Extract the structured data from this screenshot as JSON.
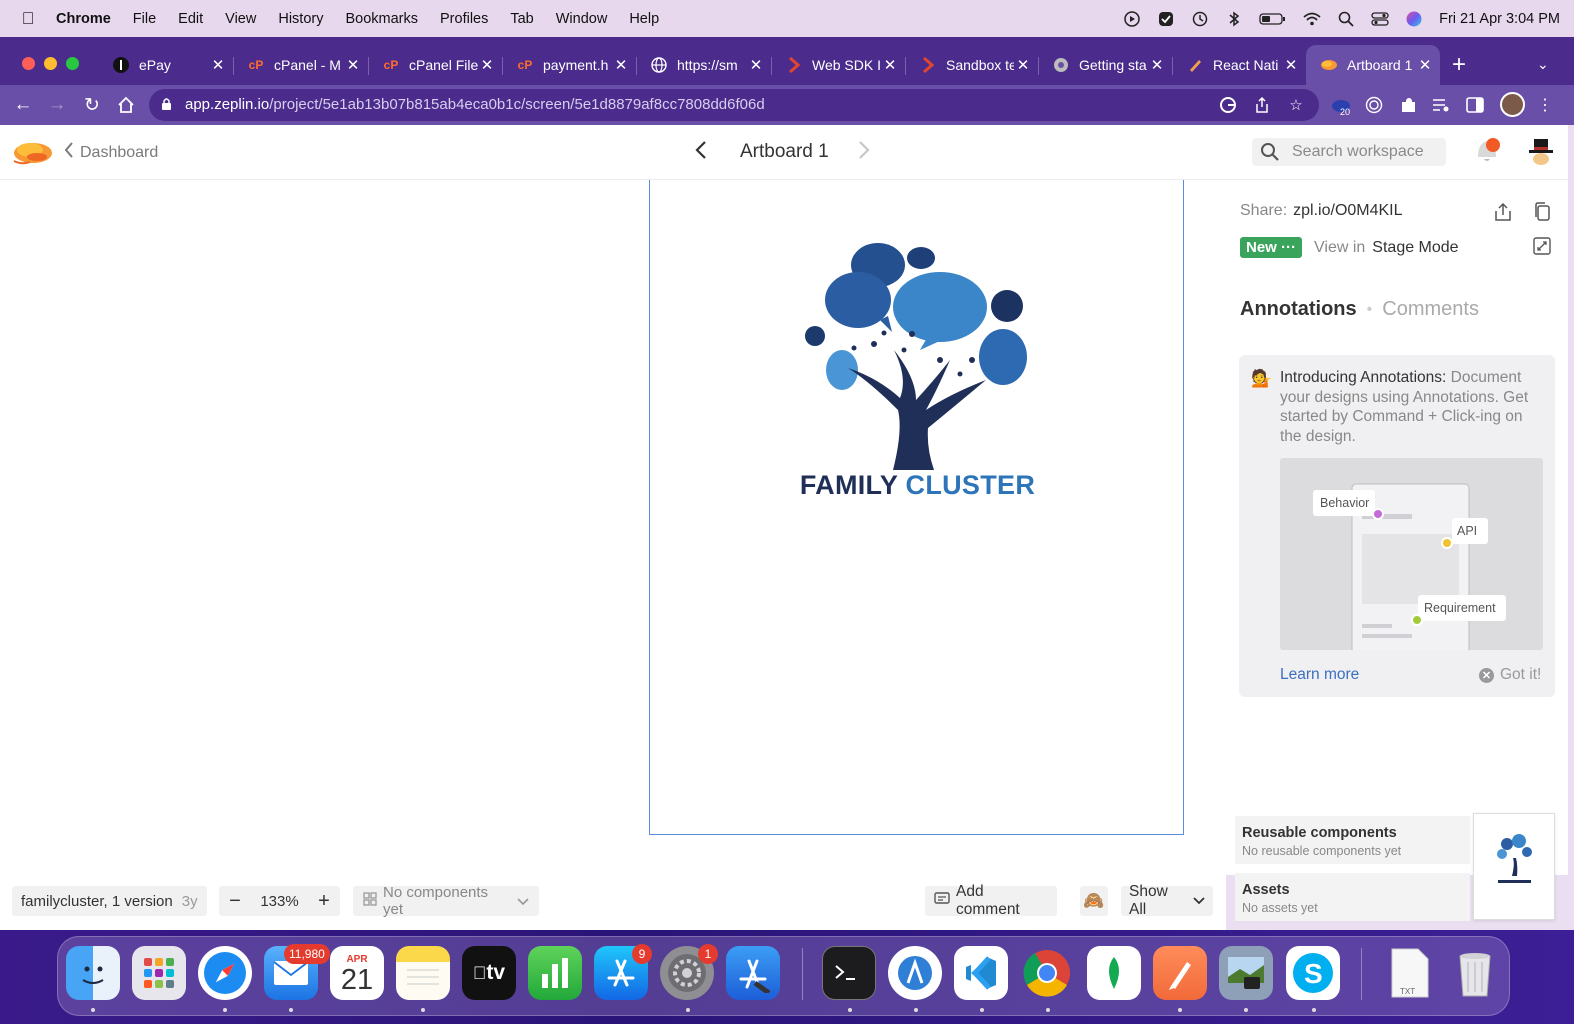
{
  "menubar": {
    "app_name": "Chrome",
    "items": [
      "File",
      "Edit",
      "View",
      "History",
      "Bookmarks",
      "Profiles",
      "Tab",
      "Window",
      "Help"
    ],
    "clock": "Fri 21 Apr  3:04 PM"
  },
  "tabs": [
    {
      "title": "ePay",
      "icon": "epay-icon"
    },
    {
      "title": "cPanel - M",
      "icon": "cpanel-icon"
    },
    {
      "title": "cPanel File",
      "icon": "cpanel-icon"
    },
    {
      "title": "payment.h",
      "icon": "cpanel-icon"
    },
    {
      "title": "https://sm",
      "icon": "globe-icon"
    },
    {
      "title": "Web SDK I",
      "icon": "chevron-brand-icon"
    },
    {
      "title": "Sandbox te",
      "icon": "chevron-brand-icon"
    },
    {
      "title": "Getting sta",
      "icon": "gear-icon"
    },
    {
      "title": "React Nati",
      "icon": "pen-icon"
    },
    {
      "title": "Artboard 1",
      "icon": "zeplin-icon",
      "active": true
    }
  ],
  "address": {
    "host": "app.zeplin.io",
    "path": "/project/5e1ab13b07b815ab4eca0b1c/screen/5e1d8879af8cc7808dd6f06d",
    "extension_badge": "20"
  },
  "header": {
    "back_label": "Dashboard",
    "artboard_title": "Artboard 1",
    "search_placeholder": "Search workspace"
  },
  "artboard": {
    "brand_word1": "FAMILY",
    "brand_word2": "CLUSTER"
  },
  "panel": {
    "share_label": "Share:",
    "share_link": "zpl.io/O0M4KIL",
    "new_badge": "New ···",
    "view_in": "View in",
    "stage_mode": "Stage Mode",
    "tab_annotations": "Annotations",
    "tab_comments": "Comments",
    "intro_lead": "Introducing Annotations:",
    "intro_body": " Document your designs using Annotations. Get started by Command + Click-ing on the design.",
    "illus_labels": {
      "behavior": "Behavior",
      "api": "API",
      "requirement": "Requirement"
    },
    "learn_more": "Learn more",
    "got_it": "Got it!",
    "reusable_title": "Reusable components",
    "reusable_sub": "No reusable components yet",
    "assets_title": "Assets",
    "assets_sub": "No assets yet"
  },
  "bottom": {
    "version": "familycluster, 1 version",
    "version_age": "3y",
    "zoom": "133%",
    "components": "No components yet",
    "add_comment": "Add comment",
    "show_all": "Show All"
  },
  "dock": {
    "mail_badge": "11,980",
    "calendar_month": "APR",
    "calendar_day": "21",
    "appstore_badge": "9",
    "settings_badge": "1",
    "tv_label": "tv",
    "txt_label": "TXT"
  },
  "colors": {
    "tab_strip": "#4b2c8c",
    "active_tab": "#6a4fa8",
    "new_badge": "#3aa35c",
    "link": "#3b6fc2",
    "artboard_border": "#5b8ce0",
    "brand_dark": "#1f2f57",
    "brand_blue": "#2d74b8"
  }
}
